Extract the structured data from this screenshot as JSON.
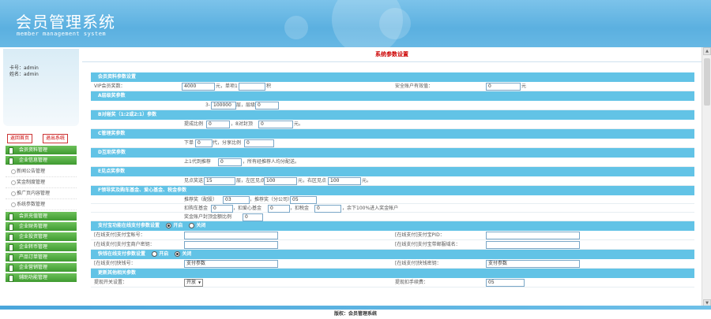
{
  "app": {
    "title": "会员管理系统",
    "subtitle": "member management system"
  },
  "user": {
    "card_line": "卡号：admin",
    "name_line": "姓名：admin"
  },
  "sidebar": {
    "back_home": "返回首页",
    "logout": "退出系统",
    "menus": [
      {
        "label": "会员资料管理"
      },
      {
        "label": "企业信息管理",
        "children": [
          "新闻公告管理",
          "奖金制度管理",
          "推广页内容管理",
          "系统参数管理"
        ]
      },
      {
        "label": "会员充值管理"
      },
      {
        "label": "企业财务管理"
      },
      {
        "label": "企业投资管理"
      },
      {
        "label": "企业转币管理"
      },
      {
        "label": "产品订单管理"
      },
      {
        "label": "企业营销管理"
      },
      {
        "label": "辅助功能管理"
      }
    ]
  },
  "main": {
    "panel_title": "系统参数设置",
    "sections": {
      "base": "会员资料参数设置",
      "a": "A层级奖参数",
      "b": "B对碰奖（1:2或2:1）参数",
      "c": "C管理奖参数",
      "d": "D互助奖参数",
      "e": "E见点奖参数",
      "f": "F领导奖及购车基金、爱心基金、税金参数",
      "pay": "支付宝功能在线支付参数设置",
      "pay_on": "开启",
      "pay_off": "关闭",
      "online": "快钱在线支付参数设置",
      "online_on": "开启",
      "online_off": "关闭",
      "more": "更新其他相关参数"
    },
    "base_row": {
      "label": "VIP会员奖数：",
      "value1": "4000",
      "unit1": "元，单项1",
      "value2": "",
      "unit2": "积",
      "label2": "安全账户有效值：",
      "value3": "0",
      "unit3": "元"
    },
    "a_row": {
      "prefix": "3-",
      "value1": "100000",
      "mid": "层，层级比例",
      "value2": "0"
    },
    "b_row": {
      "label": "提成比例",
      "value1": "0",
      "mid": "，8对封顶",
      "value2": "0",
      "unit": "元。"
    },
    "c_row": {
      "label": "下单",
      "value1": "0",
      "mid": "代，分享比例",
      "value2": "0"
    },
    "d_row": {
      "label": "上1代到推荐",
      "value1": "0",
      "mid": "，所有经推荐人均分配送。"
    },
    "e_row": {
      "label": "见点奖送15",
      "value1": "15",
      "mid1": "层，左区见点",
      "value2": "100",
      "unit1": "元，右区见点",
      "value3": "100",
      "unit2": "元。"
    },
    "f_rows": {
      "r1_label": "推荐奖（配股）",
      "r1_value": "03",
      "r1_mid": "，推荐奖（分公司）",
      "r1_value2": "05",
      "r2_label": "扣购车基金",
      "r2_value": "0",
      "r2_mid": "，扣爱心基金",
      "r2_value2": "0",
      "r2_mid2": "，扣税金",
      "r2_value3": "0",
      "r2_tail": "，余下100%进入奖金帐户",
      "r3_label": "奖金账户封顶金额比例",
      "r3_value": "0"
    },
    "pay_rows": {
      "l1": "[在线支付]支付宝帐号：",
      "r1": "[在线支付]支付宝PID：",
      "l2": "[在线支付]支付宝商户密钥：",
      "r2": "[在线支付]支付宝带邮服域名："
    },
    "online_rows": {
      "l1": "[在线支付]快钱号：",
      "v1": "支付参数",
      "r1": "[在线支付]快钱密钥：",
      "v2": "支付参数"
    },
    "more_row": {
      "l1": "提现开关设置：",
      "select": "开放",
      "r1": "提现扣手续费：",
      "v1": "05"
    }
  },
  "footer": {
    "text": "版权：会员管理系统"
  },
  "colors": {
    "header": "#5bb0e0",
    "section_bar": "#62c3e6",
    "menu_green": "#3f9a30",
    "title_red": "#cc0000"
  }
}
